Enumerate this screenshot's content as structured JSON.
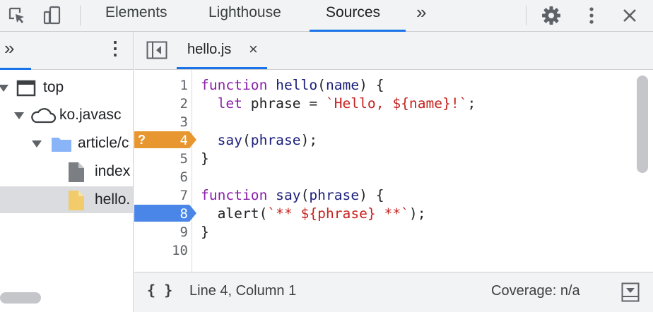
{
  "toolbar": {
    "tabs": [
      {
        "label": "Elements"
      },
      {
        "label": "Lighthouse"
      },
      {
        "label": "Sources"
      }
    ],
    "more_tabs": "»",
    "icons": [
      "inspect-icon",
      "device-toggle-icon",
      "settings-gear-icon",
      "more-vertical-icon",
      "close-icon"
    ]
  },
  "navigator": {
    "more": "»",
    "menu": "⋮",
    "tree": [
      {
        "label": "top",
        "icon": "frame-icon"
      },
      {
        "label": "ko.javasc",
        "icon": "cloud-icon"
      },
      {
        "label": "article/c",
        "icon": "folder-icon"
      },
      {
        "label": "index",
        "icon": "file-icon"
      },
      {
        "label": "hello.",
        "icon": "js-file-icon"
      }
    ]
  },
  "editor": {
    "file_tab": {
      "label": "hello.js",
      "close": "×"
    },
    "lines": [
      {
        "n": "1",
        "code": "function hello(name) {"
      },
      {
        "n": "2",
        "code": "  let phrase = `Hello, ${name}!`;"
      },
      {
        "n": "3",
        "code": ""
      },
      {
        "n": "4",
        "code": "  say(phrase);"
      },
      {
        "n": "5",
        "code": "}"
      },
      {
        "n": "6",
        "code": ""
      },
      {
        "n": "7",
        "code": "function say(phrase) {"
      },
      {
        "n": "8",
        "code": "  alert(`** ${phrase} **`);"
      },
      {
        "n": "9",
        "code": "}"
      },
      {
        "n": "10",
        "code": ""
      }
    ],
    "breakpoints": [
      {
        "line": "4",
        "type": "conditional",
        "marker": "?",
        "color": "#e8962f"
      },
      {
        "line": "8",
        "type": "regular",
        "color": "#4a86e8"
      }
    ]
  },
  "status": {
    "format": "{ }",
    "position": "Line 4, Column 1",
    "coverage": "Coverage: n/a"
  },
  "colors": {
    "accent": "#1a73e8",
    "keyword": "#8a1fa8",
    "string": "#c5221f"
  }
}
